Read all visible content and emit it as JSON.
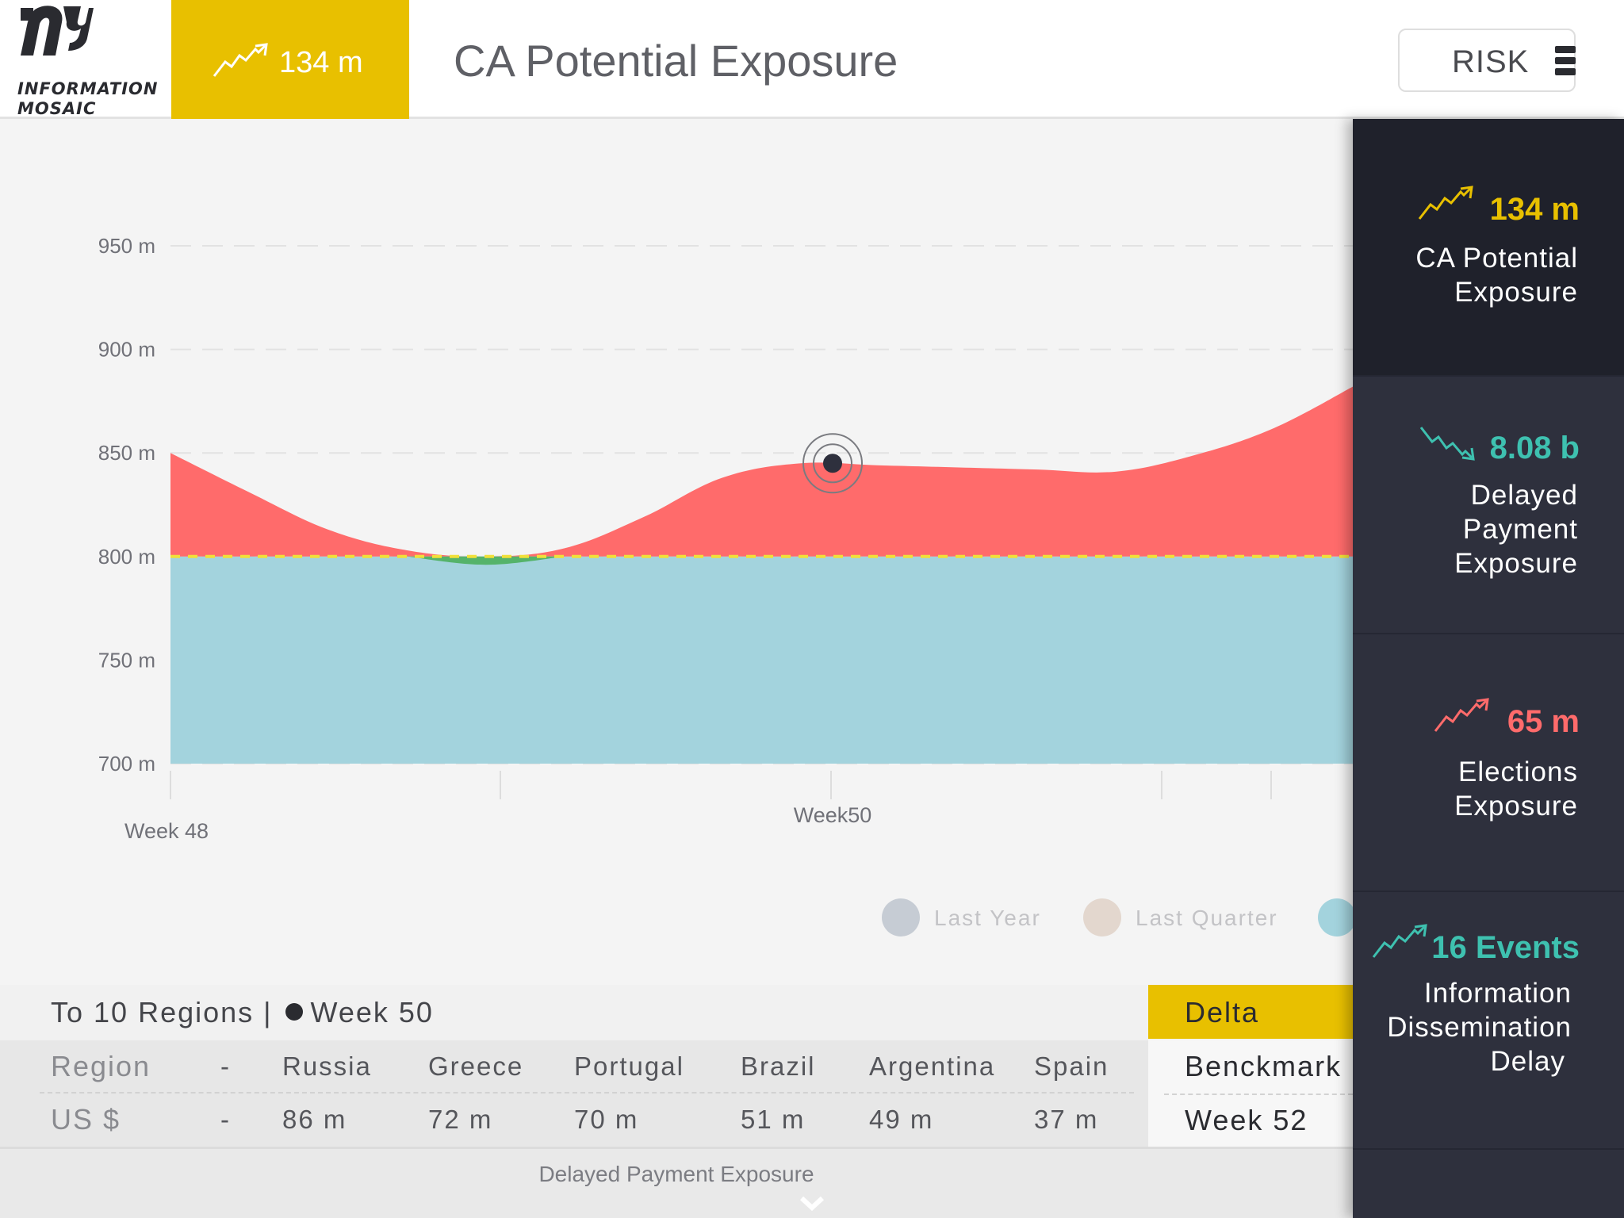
{
  "brand": {
    "line1": "INFORMATION",
    "line2": "MOSAIC"
  },
  "header": {
    "kpi_value": "134 m",
    "title": "CA Potential Exposure",
    "risk_label": "RISK",
    "kpi_color": "#e8c000"
  },
  "chart_data": {
    "type": "area",
    "y_ticks": [
      "950 m",
      "900 m",
      "850 m",
      "800 m",
      "750 m",
      "700 m"
    ],
    "ylim": [
      700,
      950
    ],
    "x_labels": [
      "Week 48",
      "Week50"
    ],
    "baseline": 800,
    "marker": {
      "week": 50,
      "value": 845
    },
    "series": [
      {
        "color": "#a3d3dd",
        "values": [
          800,
          800,
          800,
          800,
          800,
          800,
          800,
          800,
          800,
          800,
          800,
          800,
          800,
          800,
          800,
          800
        ]
      },
      {
        "color": "#ff6b6b",
        "values": [
          850,
          831,
          813,
          803,
          800,
          804,
          819,
          838,
          845,
          844,
          843,
          842,
          841,
          849,
          862,
          882
        ]
      },
      {
        "color": "#55b36a",
        "values": [
          800,
          800,
          800,
          800,
          796,
          800,
          800,
          800,
          800,
          800,
          800,
          800,
          800,
          800,
          800,
          800
        ]
      }
    ],
    "legend": [
      {
        "label": "Last Year",
        "color": "#c6ccd4"
      },
      {
        "label": "Last Quarter",
        "color": "#e3d7ce"
      },
      {
        "label": "",
        "color": "#a3d3dd"
      }
    ],
    "grid": true,
    "baseline_color": "#f0e03a"
  },
  "table": {
    "title": "To 10 Regions |",
    "week": "Week 50",
    "delta_label": "Delta",
    "columns": [
      "Region",
      "-",
      "Russia",
      "Greece",
      "Portugal",
      "Brazil",
      "Argentina",
      "Spain"
    ],
    "values": [
      "US $",
      "-",
      "86 m",
      "72 m",
      "70 m",
      "51 m",
      "49 m",
      "37 m"
    ],
    "benchmark_label": "Benckmark",
    "benchmark_value": "Week 52"
  },
  "footer": {
    "label": "Delayed Payment Exposure"
  },
  "side_panel": [
    {
      "value": "134 m",
      "label_lines": [
        "CA Potential",
        "Exposure"
      ],
      "color": "#e8c000",
      "icon": "trend-up-icon"
    },
    {
      "value": "8.08 b",
      "label_lines": [
        "Delayed",
        "Payment",
        "Exposure"
      ],
      "color": "#3ec1b0",
      "icon": "trend-down-icon"
    },
    {
      "value": "65 m",
      "label_lines": [
        "Elections",
        "Exposure"
      ],
      "color": "#ff6b6b",
      "icon": "trend-up-icon"
    },
    {
      "value": "16 Events",
      "label_lines": [
        "Information",
        "Dissemination",
        "Delay"
      ],
      "color": "#3ec1b0",
      "icon": "trend-up-icon"
    }
  ]
}
